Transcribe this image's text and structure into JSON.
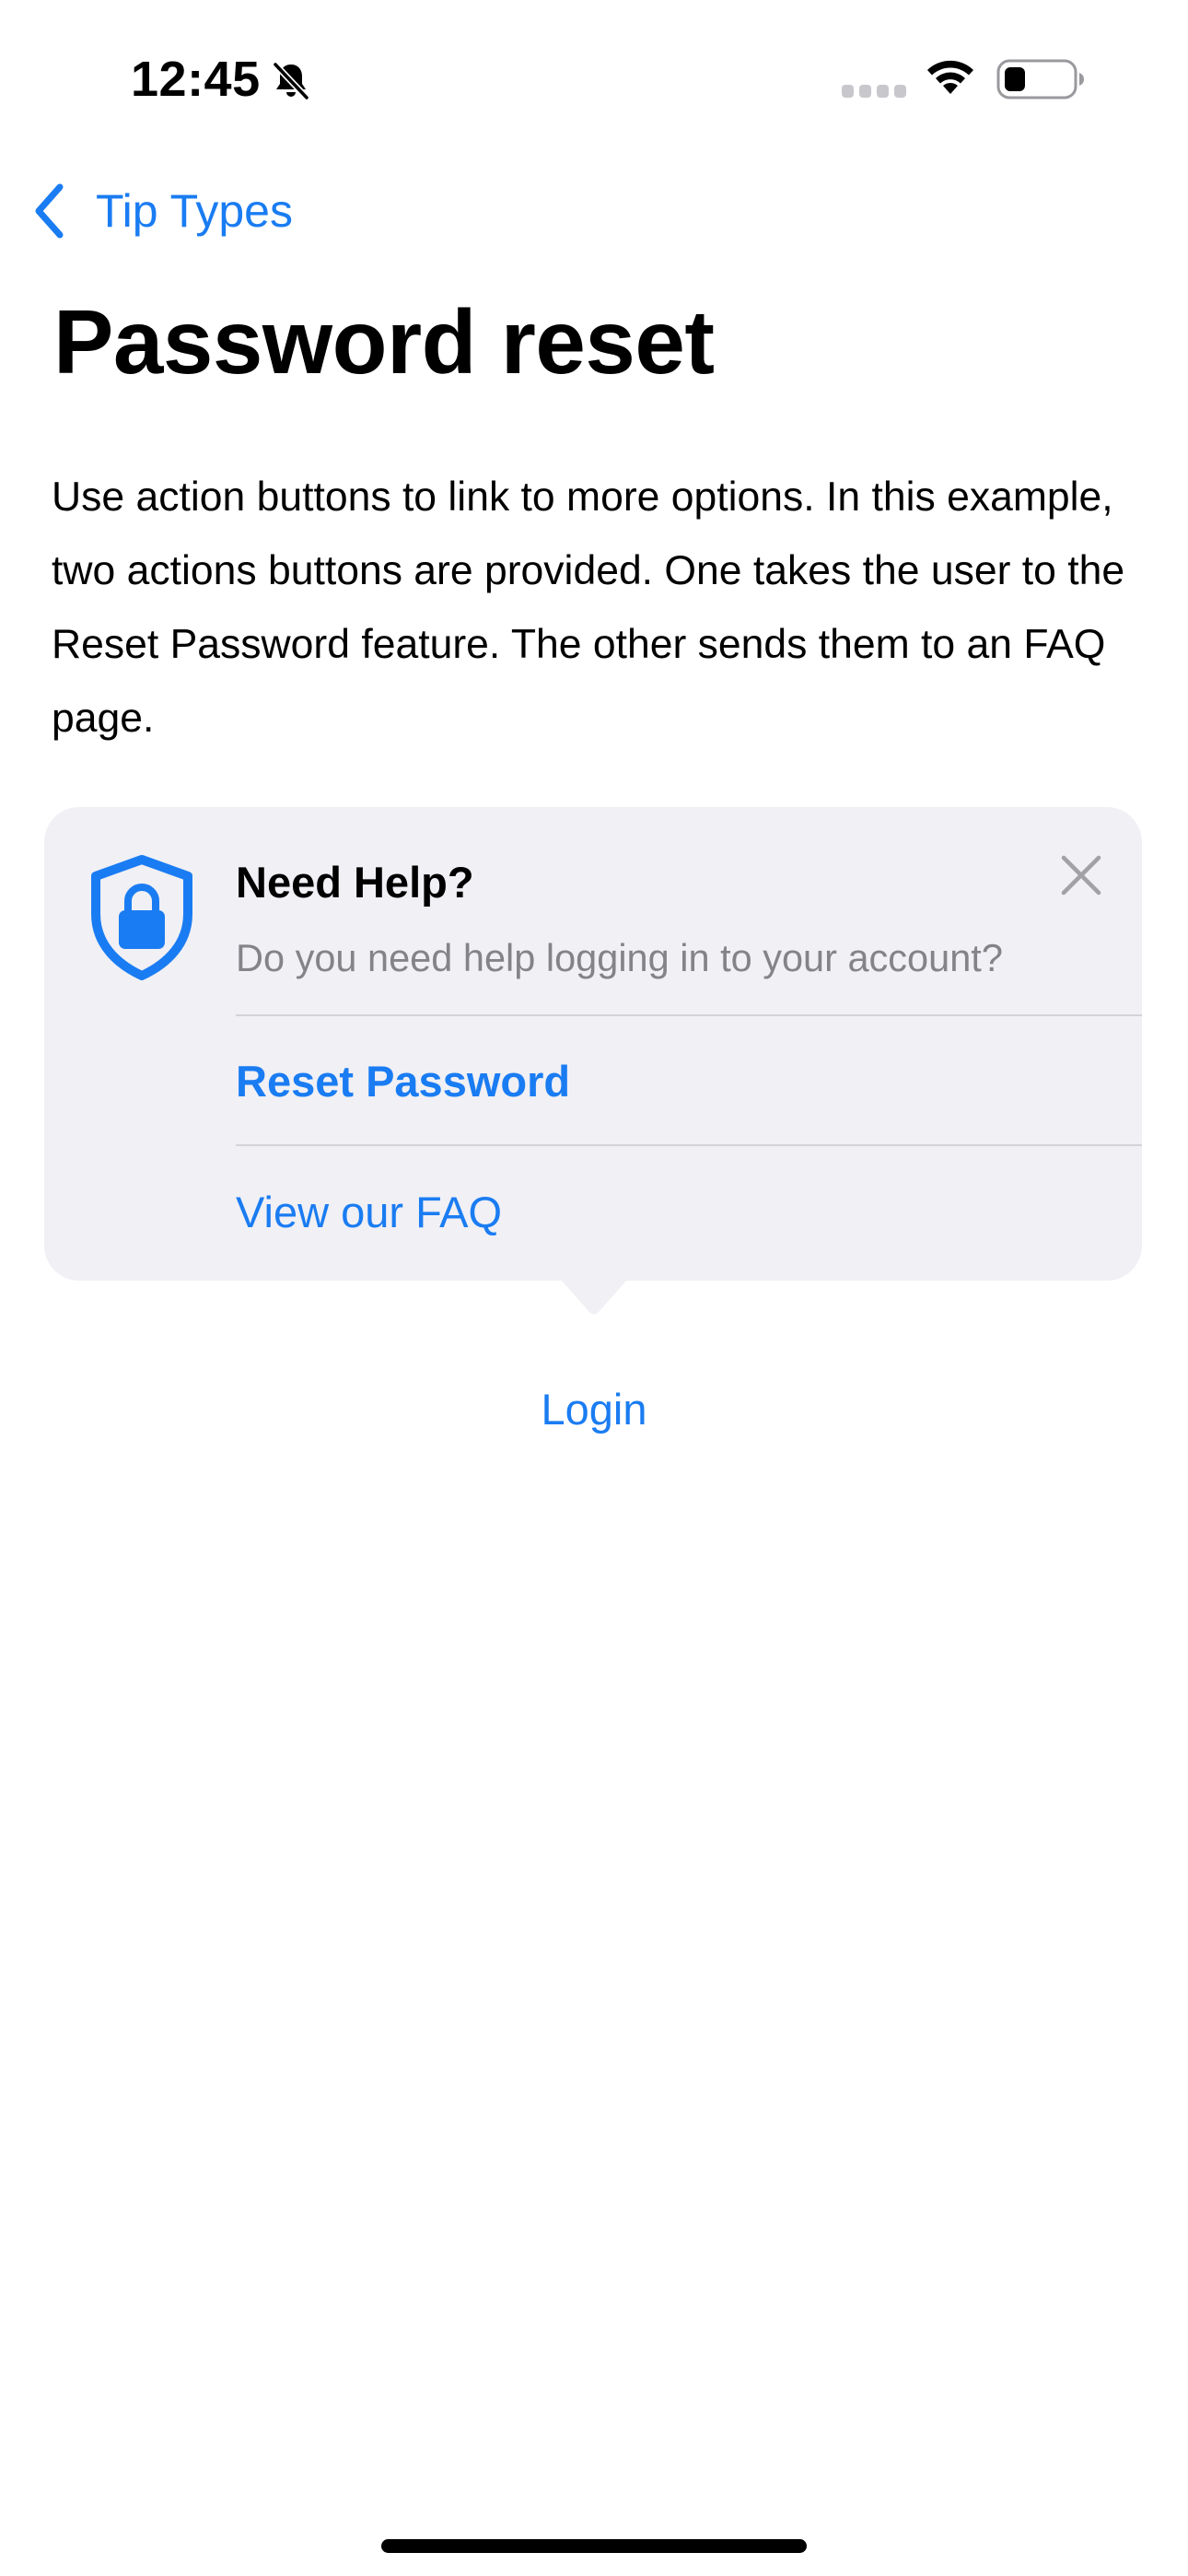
{
  "status_bar": {
    "time": "12:45",
    "silent_mode": true,
    "cellular_signal": "no-service",
    "wifi": "full",
    "battery_level_fraction": 0.25
  },
  "nav": {
    "back_label": "Tip Types",
    "back_icon": "chevron-left-icon"
  },
  "page": {
    "title": "Password reset",
    "description": "Use action buttons to link to more options. In this example, two actions buttons are provided. One takes the user to the Reset Password feature. The other sends them to an FAQ page."
  },
  "tip": {
    "icon": "lock-shield-icon",
    "title": "Need Help?",
    "message": "Do you need help logging in to your account?",
    "actions": [
      {
        "label": "Reset Password",
        "emphasized": true
      },
      {
        "label": "View our FAQ",
        "emphasized": false
      }
    ],
    "close_icon": "close-icon",
    "background_color": "#f0f0f5"
  },
  "login": {
    "label": "Login"
  },
  "colors": {
    "accent": "#1a7cf2",
    "secondary_text": "#838388",
    "divider": "#d3d3d8"
  }
}
